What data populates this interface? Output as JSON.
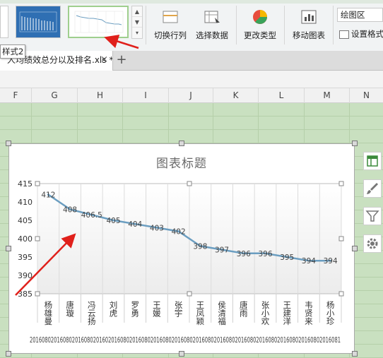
{
  "ribbon": {
    "tooltip": "样式2",
    "switch_row_col": "切换行列",
    "select_data": "选择数据",
    "change_type": "更改类型",
    "move_chart": "移动图表",
    "chart_area_select": "绘图区",
    "set_format": "设置格式",
    "accent_color": "#9fcf8e"
  },
  "tabs": {
    "document": "人均绩效总分以及排名.xls *",
    "close": "×",
    "new_tab": "+"
  },
  "columns": [
    "F",
    "G",
    "H",
    "I",
    "J",
    "K",
    "L",
    "M",
    "N"
  ],
  "chart_data": {
    "type": "line",
    "title": "图表标题",
    "ylim": [
      385,
      415
    ],
    "yticks": [
      385,
      390,
      395,
      400,
      405,
      410,
      415
    ],
    "categories": [
      "杨雄曼",
      "唐璇",
      "冯云扬",
      "刘虎",
      "罗勇",
      "王媛",
      "张宇",
      "王凤颖",
      "侯清福",
      "唐雨",
      "张小欢",
      "王建洋",
      "韦贤来",
      "杨小珍"
    ],
    "values": [
      412,
      408,
      406.5,
      405,
      404,
      403,
      402,
      398,
      397,
      396,
      396,
      395,
      394,
      394
    ],
    "value_labels": [
      "412",
      "408",
      "406.5",
      "405",
      "404",
      "403",
      "402",
      "398",
      "397",
      "396",
      "396",
      "395",
      "394",
      "394"
    ],
    "bottom_text": "2016080201608020160802016020160802016080201608020160802016080201608020160802016080201608020160802016081",
    "line_color": "#6b9ec1",
    "grid": true
  }
}
